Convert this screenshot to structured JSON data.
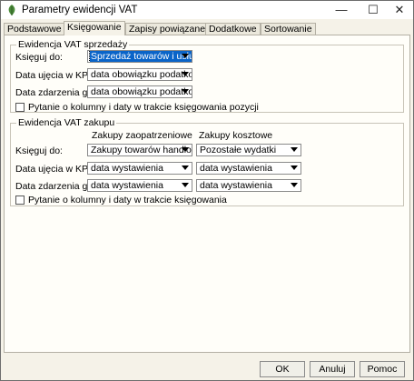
{
  "window": {
    "title": "Parametry ewidencji VAT",
    "controls": {
      "minimize": "—",
      "maximize": "☐",
      "close": "✕"
    },
    "icon": "leaf-icon"
  },
  "tabs": [
    {
      "label": "Podstawowe",
      "active": false
    },
    {
      "label": "Księgowanie",
      "active": true
    },
    {
      "label": "Zapisy powiązane",
      "active": false
    },
    {
      "label": "Dodatkowe",
      "active": false
    },
    {
      "label": "Sortowanie",
      "active": false
    }
  ],
  "sales": {
    "legend": "Ewidencja VAT sprzedaży",
    "rows": [
      {
        "label": "Księguj do:",
        "value": "Sprzedaż towarów i usług"
      },
      {
        "label": "Data ujęcia w KPiR:",
        "value": "data obowiązku podatkowego"
      },
      {
        "label": "Data zdarzenia gosp.:",
        "value": "data obowiązku podatkowego"
      }
    ],
    "checkbox": {
      "label": "Pytanie o kolumny i daty w trakcie księgowania pozycji",
      "checked": false
    }
  },
  "purchase": {
    "legend": "Ewidencja VAT zakupu",
    "col_headers": [
      "Zakupy zaopatrzeniowe",
      "Zakupy kosztowe"
    ],
    "rows": [
      {
        "label": "Księguj do:",
        "values": [
          "Zakupy towarów handlowych",
          "Pozostałe wydatki"
        ]
      },
      {
        "label": "Data ujęcia w KPiR:",
        "values": [
          "data wystawienia",
          "data wystawienia"
        ]
      },
      {
        "label": "Data zdarzenia gosp.:",
        "values": [
          "data wystawienia",
          "data wystawienia"
        ]
      }
    ],
    "checkbox": {
      "label": "Pytanie o kolumny i daty w trakcie księgowania",
      "checked": false
    }
  },
  "buttons": {
    "ok": "OK",
    "cancel": "Anuluj",
    "help": "Pomoc"
  }
}
